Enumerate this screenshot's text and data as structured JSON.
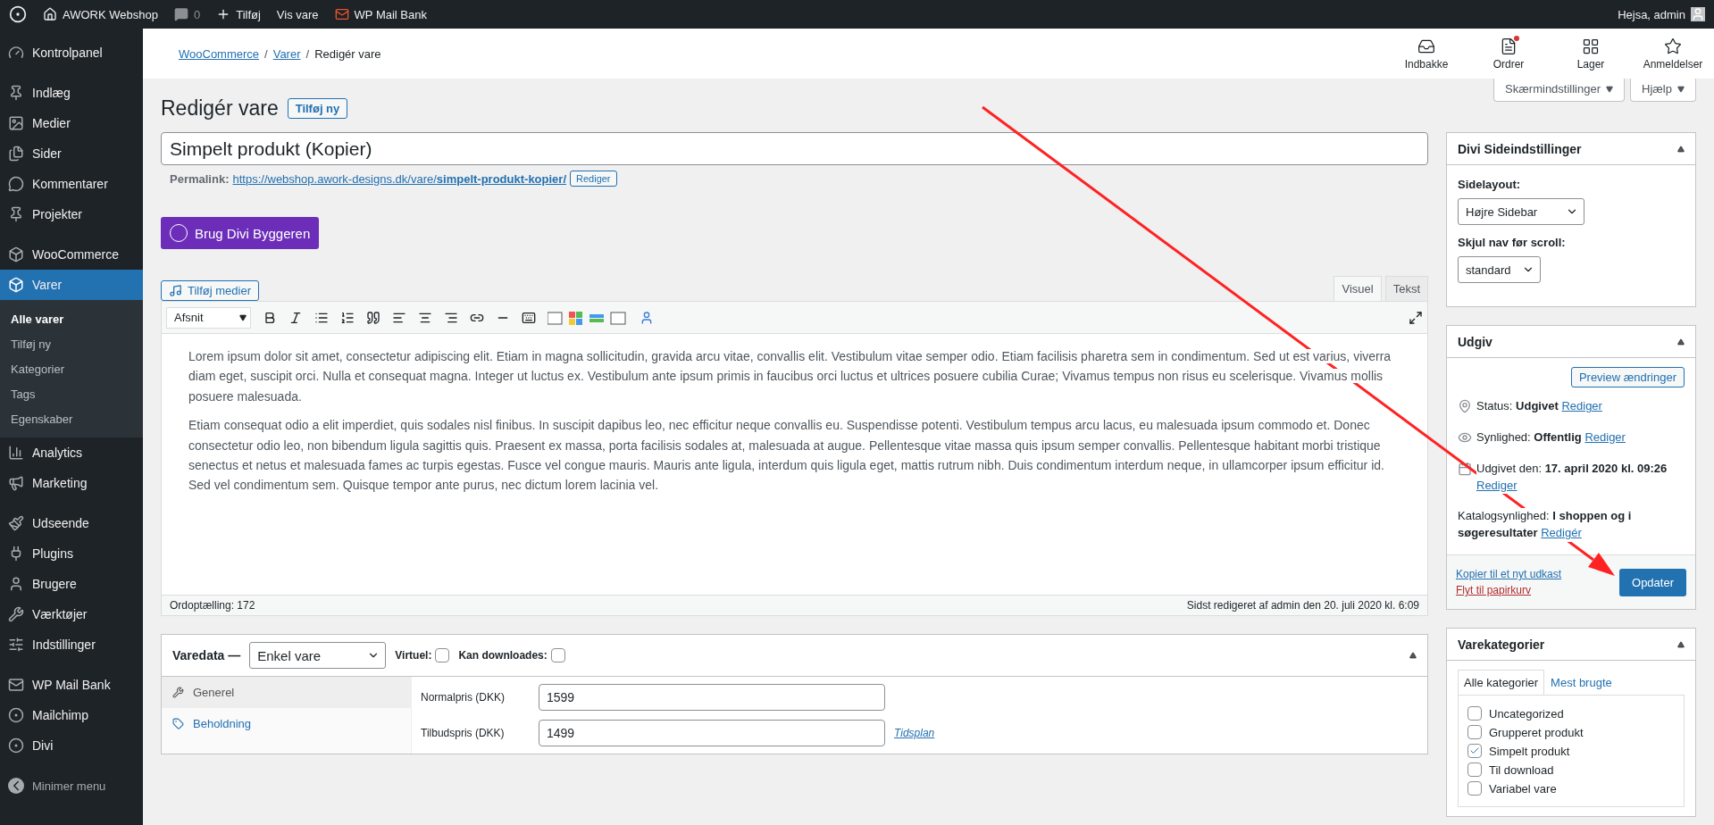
{
  "admin_bar": {
    "site": "AWORK Webshop",
    "comments": "0",
    "new": "Tilføj",
    "view": "Vis vare",
    "plugin": "WP Mail Bank",
    "greeting": "Hejsa, admin"
  },
  "sidebar": {
    "groups": [
      {
        "items": [
          {
            "label": "Kontrolpanel",
            "selected": false
          }
        ]
      },
      {
        "items": [
          {
            "label": "Indlæg",
            "selected": false
          },
          {
            "label": "Medier",
            "selected": false
          },
          {
            "label": "Sider",
            "selected": false
          },
          {
            "label": "Kommentarer",
            "selected": false
          },
          {
            "label": "Projekter",
            "selected": false
          }
        ]
      },
      {
        "items": [
          {
            "label": "WooCommerce",
            "selected": false
          },
          {
            "label": "Varer",
            "selected": true,
            "children": [
              {
                "label": "Alle varer",
                "selected": true
              },
              {
                "label": "Tilføj ny",
                "selected": false
              },
              {
                "label": "Kategorier",
                "selected": false
              },
              {
                "label": "Tags",
                "selected": false
              },
              {
                "label": "Egenskaber",
                "selected": false
              }
            ]
          },
          {
            "label": "Analytics",
            "selected": false
          },
          {
            "label": "Marketing",
            "selected": false
          }
        ]
      },
      {
        "items": [
          {
            "label": "Udseende",
            "selected": false
          },
          {
            "label": "Plugins",
            "selected": false
          },
          {
            "label": "Brugere",
            "selected": false
          },
          {
            "label": "Værktøjer",
            "selected": false
          },
          {
            "label": "Indstillinger",
            "selected": false
          }
        ]
      },
      {
        "items": [
          {
            "label": "WP Mail Bank",
            "selected": false
          },
          {
            "label": "Mailchimp",
            "selected": false
          },
          {
            "label": "Divi",
            "selected": false
          }
        ]
      }
    ],
    "collapse": "Minimer menu"
  },
  "header": {
    "separator": "/",
    "breadcrumbs": [
      {
        "label": "WooCommerce",
        "link": true
      },
      {
        "label": "Varer",
        "link": true
      },
      {
        "label": "Redigér vare",
        "link": false
      }
    ],
    "activity": [
      {
        "label": "Indbakke",
        "notification": false
      },
      {
        "label": "Ordrer",
        "notification": true
      },
      {
        "label": "Lager",
        "notification": false
      },
      {
        "label": "Anmeldelser",
        "notification": false
      }
    ]
  },
  "screen_buttons": [
    "Skærmindstillinger",
    "Hjælp"
  ],
  "page_title": "Redigér vare",
  "add_new": "Tilføj ny",
  "post_title": "Simpelt produkt (Kopier)",
  "permalink": {
    "label": "Permalink:",
    "base": "https://webshop.awork-designs.dk/vare/",
    "slug": "simpelt-produkt-kopier/",
    "button": "Rediger"
  },
  "divi_button": "Brug Divi Byggeren",
  "editor": {
    "media_button": "Tilføj medier",
    "tabs": [
      {
        "label": "Visuel",
        "selected": true
      },
      {
        "label": "Tekst",
        "selected": false
      }
    ],
    "format": "Afsnit",
    "paragraphs": [
      "Lorem ipsum dolor sit amet, consectetur adipiscing elit. Etiam in magna sollicitudin, gravida arcu vitae, convallis elit. Vestibulum vitae semper odio. Etiam facilisis pharetra sem in condimentum. Sed ut est varius, viverra diam eget, suscipit orci. Nulla et consequat magna. Integer ut luctus ex. Vestibulum ante ipsum primis in faucibus orci luctus et ultrices posuere cubilia Curae; Vivamus tempus non risus eu scelerisque. Vivamus mollis posuere malesuada.",
      "Etiam consequat odio a elit imperdiet, quis sodales nisl finibus. In suscipit dapibus leo, nec efficitur neque convallis eu. Suspendisse potenti. Vestibulum tempus arcu lacus, eu malesuada ipsum commodo et. Donec consectetur odio leo, non bibendum ligula sagittis quis. Praesent ex massa, porta facilisis sodales at, malesuada at augue. Pellentesque vitae massa quis ipsum semper convallis. Pellentesque habitant morbi tristique senectus et netus et malesuada fames ac turpis egestas. Fusce vel congue mauris. Mauris ante ligula, interdum quis ligula eget, mattis rutrum nibh. Duis condimentum interdum neque, in ullamcorper ipsum efficitur id. Sed vel condimentum sem. Quisque tempor ante purus, nec dictum lorem lacinia vel."
    ],
    "word_count": "Ordoptælling: 172",
    "last_edited": "Sidst redigeret af admin den 20. juli 2020 kl. 6:09"
  },
  "product_data": {
    "title": "Varedata —",
    "type": "Enkel vare",
    "options": [
      {
        "label": "Virtuel:",
        "checked": false
      },
      {
        "label": "Kan downloades:",
        "checked": false
      }
    ],
    "tabs": [
      {
        "label": "Generel",
        "selected": true
      },
      {
        "label": "Beholdning",
        "selected": false
      }
    ],
    "fields": [
      {
        "label": "Normalpris (DKK)",
        "value": "1599"
      },
      {
        "label": "Tilbudspris (DKK)",
        "value": "1499",
        "link": "Tidsplan"
      }
    ]
  },
  "divi_settings": {
    "title": "Divi Sideindstillinger",
    "fields": [
      {
        "label": "Sidelayout:",
        "value": "Højre Sidebar"
      },
      {
        "label": "Skjul nav før scroll:",
        "value": "standard"
      }
    ]
  },
  "publish": {
    "title": "Udgiv",
    "preview": "Preview ændringer",
    "rows": [
      {
        "kind": "status",
        "label": "Status:",
        "value": "Udgivet",
        "link": "Rediger"
      },
      {
        "kind": "visibility",
        "label": "Synlighed:",
        "value": "Offentlig",
        "link": "Rediger"
      },
      {
        "kind": "date",
        "label": "Udgivet den:",
        "value": "17. april 2020 kl. 09:26",
        "link": "Rediger"
      },
      {
        "kind": "catalog",
        "label": "Katalogsynlighed:",
        "value": "I shoppen og i søgeresultater",
        "link": "Redigér"
      }
    ],
    "copy": "Kopier til et nyt udkast",
    "trash": "Flyt til papirkurv",
    "update": "Opdater"
  },
  "categories": {
    "title": "Varekategorier",
    "tabs": [
      {
        "label": "Alle kategorier",
        "selected": true
      },
      {
        "label": "Mest brugte",
        "selected": false
      }
    ],
    "items": [
      {
        "label": "Uncategorized",
        "checked": false
      },
      {
        "label": "Grupperet produkt",
        "checked": false
      },
      {
        "label": "Simpelt produkt",
        "checked": true
      },
      {
        "label": "Til download",
        "checked": false
      },
      {
        "label": "Variabel vare",
        "checked": false
      }
    ]
  }
}
